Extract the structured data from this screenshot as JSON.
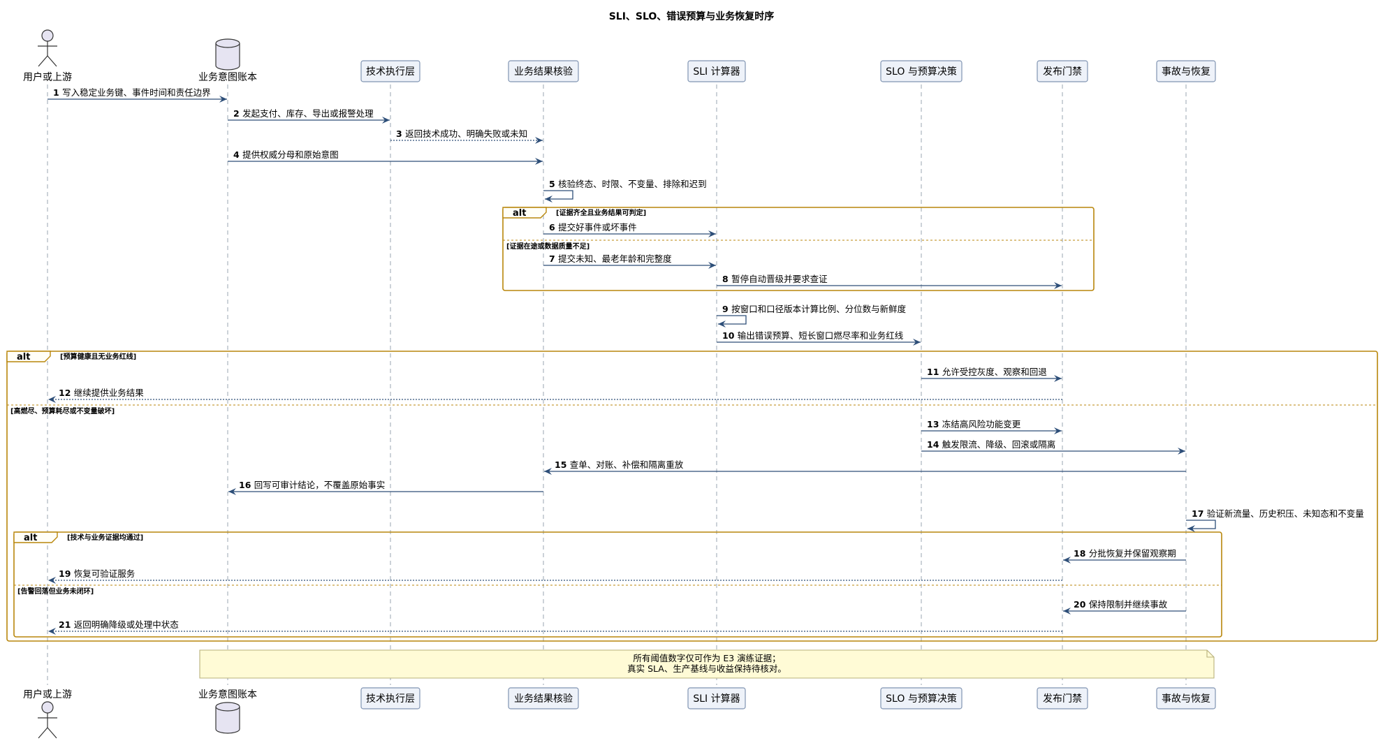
{
  "title": "SLI、SLO、错误预算与业务恢复时序",
  "colors": {
    "arrow": "#2d4e78",
    "lifeline": "#9aa5b1",
    "participant_fill": "#eef2f9",
    "participant_stroke": "#8094b2",
    "frame": "#b8860b",
    "note_fill": "#fffbd6",
    "note_stroke": "#b8b07a"
  },
  "participants": [
    {
      "id": "user",
      "label": "用户或上游",
      "kind": "actor",
      "icon": "actor-stick-figure-icon"
    },
    {
      "id": "ledger",
      "label": "业务意图账本",
      "kind": "database",
      "icon": "database-cylinder-icon"
    },
    {
      "id": "tech",
      "label": "技术执行层",
      "kind": "box"
    },
    {
      "id": "verify",
      "label": "业务结果核验",
      "kind": "box"
    },
    {
      "id": "sli",
      "label": "SLI 计算器",
      "kind": "box"
    },
    {
      "id": "slo",
      "label": "SLO 与预算决策",
      "kind": "box"
    },
    {
      "id": "gate",
      "label": "发布门禁",
      "kind": "box"
    },
    {
      "id": "incident",
      "label": "事故与恢复",
      "kind": "box"
    }
  ],
  "messages": [
    {
      "num": "1",
      "from": "user",
      "to": "ledger",
      "text": "写入稳定业务键、事件时间和责任边界",
      "dashed": false
    },
    {
      "num": "2",
      "from": "ledger",
      "to": "tech",
      "text": "发起支付、库存、导出或报警处理",
      "dashed": false
    },
    {
      "num": "3",
      "from": "tech",
      "to": "verify",
      "text": "返回技术成功、明确失败或未知",
      "dashed": true
    },
    {
      "num": "4",
      "from": "ledger",
      "to": "verify",
      "text": "提供权威分母和原始意图",
      "dashed": false
    },
    {
      "num": "5",
      "from": "verify",
      "to": "verify",
      "text": "核验终态、时限、不变量、排除和迟到",
      "dashed": false
    },
    {
      "num": "6",
      "from": "verify",
      "to": "sli",
      "text": "提交好事件或坏事件",
      "dashed": false
    },
    {
      "num": "7",
      "from": "verify",
      "to": "sli",
      "text": "提交未知、最老年龄和完整度",
      "dashed": false
    },
    {
      "num": "8",
      "from": "sli",
      "to": "gate",
      "text": "暂停自动晋级并要求查证",
      "dashed": false
    },
    {
      "num": "9",
      "from": "sli",
      "to": "sli",
      "text": "按窗口和口径版本计算比例、分位数与新鲜度",
      "dashed": false
    },
    {
      "num": "10",
      "from": "sli",
      "to": "slo",
      "text": "输出错误预算、短长窗口燃尽率和业务红线",
      "dashed": false
    },
    {
      "num": "11",
      "from": "slo",
      "to": "gate",
      "text": "允许受控灰度、观察和回退",
      "dashed": false
    },
    {
      "num": "12",
      "from": "gate",
      "to": "user",
      "text": "继续提供业务结果",
      "dashed": true
    },
    {
      "num": "13",
      "from": "slo",
      "to": "gate",
      "text": "冻结高风险功能变更",
      "dashed": false
    },
    {
      "num": "14",
      "from": "slo",
      "to": "incident",
      "text": "触发限流、降级、回滚或隔离",
      "dashed": false
    },
    {
      "num": "15",
      "from": "incident",
      "to": "verify",
      "text": "查单、对账、补偿和隔离重放",
      "dashed": false
    },
    {
      "num": "16",
      "from": "verify",
      "to": "ledger",
      "text": "回写可审计结论，不覆盖原始事实",
      "dashed": false
    },
    {
      "num": "17",
      "from": "incident",
      "to": "incident",
      "text": "验证新流量、历史积压、未知态和不变量",
      "dashed": false
    },
    {
      "num": "18",
      "from": "incident",
      "to": "gate",
      "text": "分批恢复并保留观察期",
      "dashed": false
    },
    {
      "num": "19",
      "from": "gate",
      "to": "user",
      "text": "恢复可验证服务",
      "dashed": true
    },
    {
      "num": "20",
      "from": "incident",
      "to": "gate",
      "text": "保持限制并继续事故",
      "dashed": false
    },
    {
      "num": "21",
      "from": "gate",
      "to": "user",
      "text": "返回明确降级或处理中状态",
      "dashed": true
    }
  ],
  "fragments": [
    {
      "label": "alt",
      "guard": "[证据齐全且业务结果可判定]",
      "else_guard": "[证据在途或数据质量不足]"
    },
    {
      "label": "alt",
      "guard": "[预算健康且无业务红线]",
      "else_guard": "[高燃尽、预算耗尽或不变量破坏]"
    },
    {
      "label": "alt",
      "guard": "[技术与业务证据均通过]",
      "else_guard": "[告警回落但业务未闭环]"
    }
  ],
  "note": {
    "lines": [
      "所有阈值数字仅可作为 E3 演练证据；",
      "真实 SLA、生产基线与收益保持待核对。"
    ]
  }
}
